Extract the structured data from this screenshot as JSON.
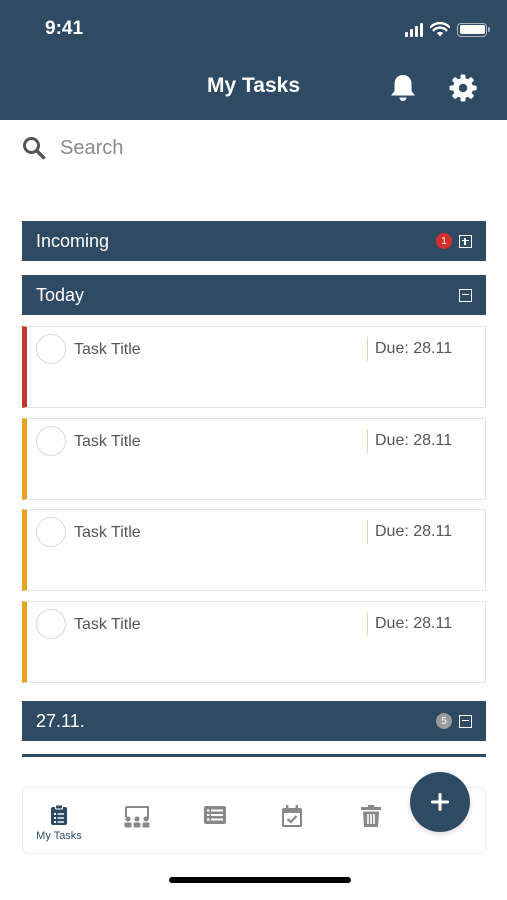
{
  "status_bar": {
    "time": "9:41"
  },
  "header": {
    "title": "My Tasks"
  },
  "search": {
    "placeholder": "Search"
  },
  "sections": {
    "incoming": {
      "label": "Incoming",
      "badge": "1"
    },
    "today": {
      "label": "Today"
    },
    "date": {
      "label": "27.11.",
      "badge": "5"
    }
  },
  "tasks": [
    {
      "title": "Task Title",
      "due": "Due: 28.11",
      "priority_color": "#c0392b"
    },
    {
      "title": "Task Title",
      "due": "Due: 28.11",
      "priority_color": "#e8a525"
    },
    {
      "title": "Task Title",
      "due": "Due: 28.11",
      "priority_color": "#e8a525"
    },
    {
      "title": "Task Title",
      "due": "Due: 28.11",
      "priority_color": "#e8a525"
    }
  ],
  "tabbar": {
    "tabs": [
      {
        "icon": "clipboard-list-icon",
        "label": "My Tasks",
        "active": true
      },
      {
        "icon": "team-icon",
        "label": ""
      },
      {
        "icon": "list-icon",
        "label": ""
      },
      {
        "icon": "calendar-check-icon",
        "label": ""
      },
      {
        "icon": "trash-icon",
        "label": ""
      }
    ]
  },
  "fab": {
    "icon": "plus-icon"
  },
  "colors": {
    "primary": "#2f4b63",
    "priority_high": "#c0392b",
    "priority_medium": "#e8a525",
    "badge_red": "#d42e2e",
    "badge_grey": "#9a9a9a"
  }
}
